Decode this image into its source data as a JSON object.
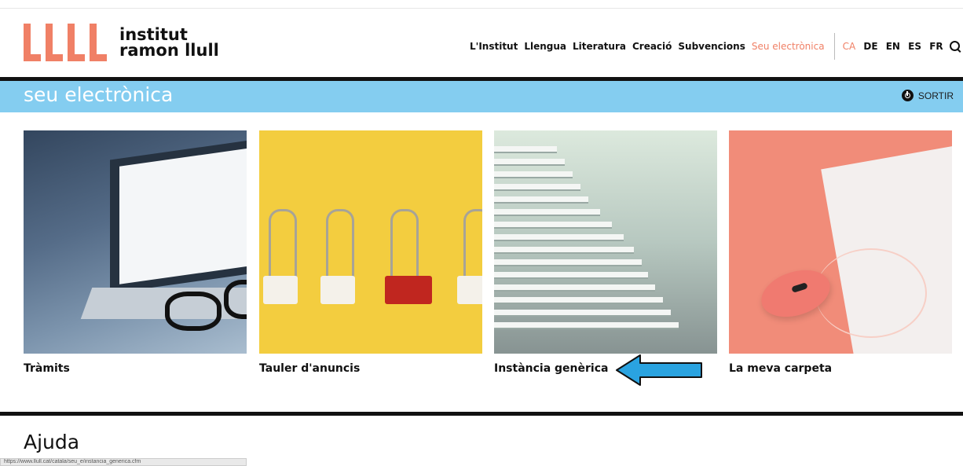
{
  "logo": {
    "line1": "institut",
    "line2": "ramon llull"
  },
  "nav": {
    "items": [
      "L'Institut",
      "Llengua",
      "Literatura",
      "Creació",
      "Subvencions",
      "Seu electrònica"
    ],
    "languages": [
      "CA",
      "DE",
      "EN",
      "ES",
      "FR"
    ]
  },
  "banner": {
    "title": "seu electrònica",
    "logout_label": "SORTIR"
  },
  "cards": [
    {
      "label": "Tràmits"
    },
    {
      "label": "Tauler d'anuncis"
    },
    {
      "label": "Instància genèrica"
    },
    {
      "label": "La meva carpeta"
    }
  ],
  "help": {
    "title": "Ajuda"
  },
  "status_url": "https://www.llull.cat/catala/seu_e/instancia_generica.cfm",
  "colors": {
    "accent": "#f08066",
    "banner": "#84cdf0",
    "arrow": "#2aa3e0"
  },
  "icons": [
    "search-icon",
    "power-icon",
    "left-arrow-icon"
  ]
}
